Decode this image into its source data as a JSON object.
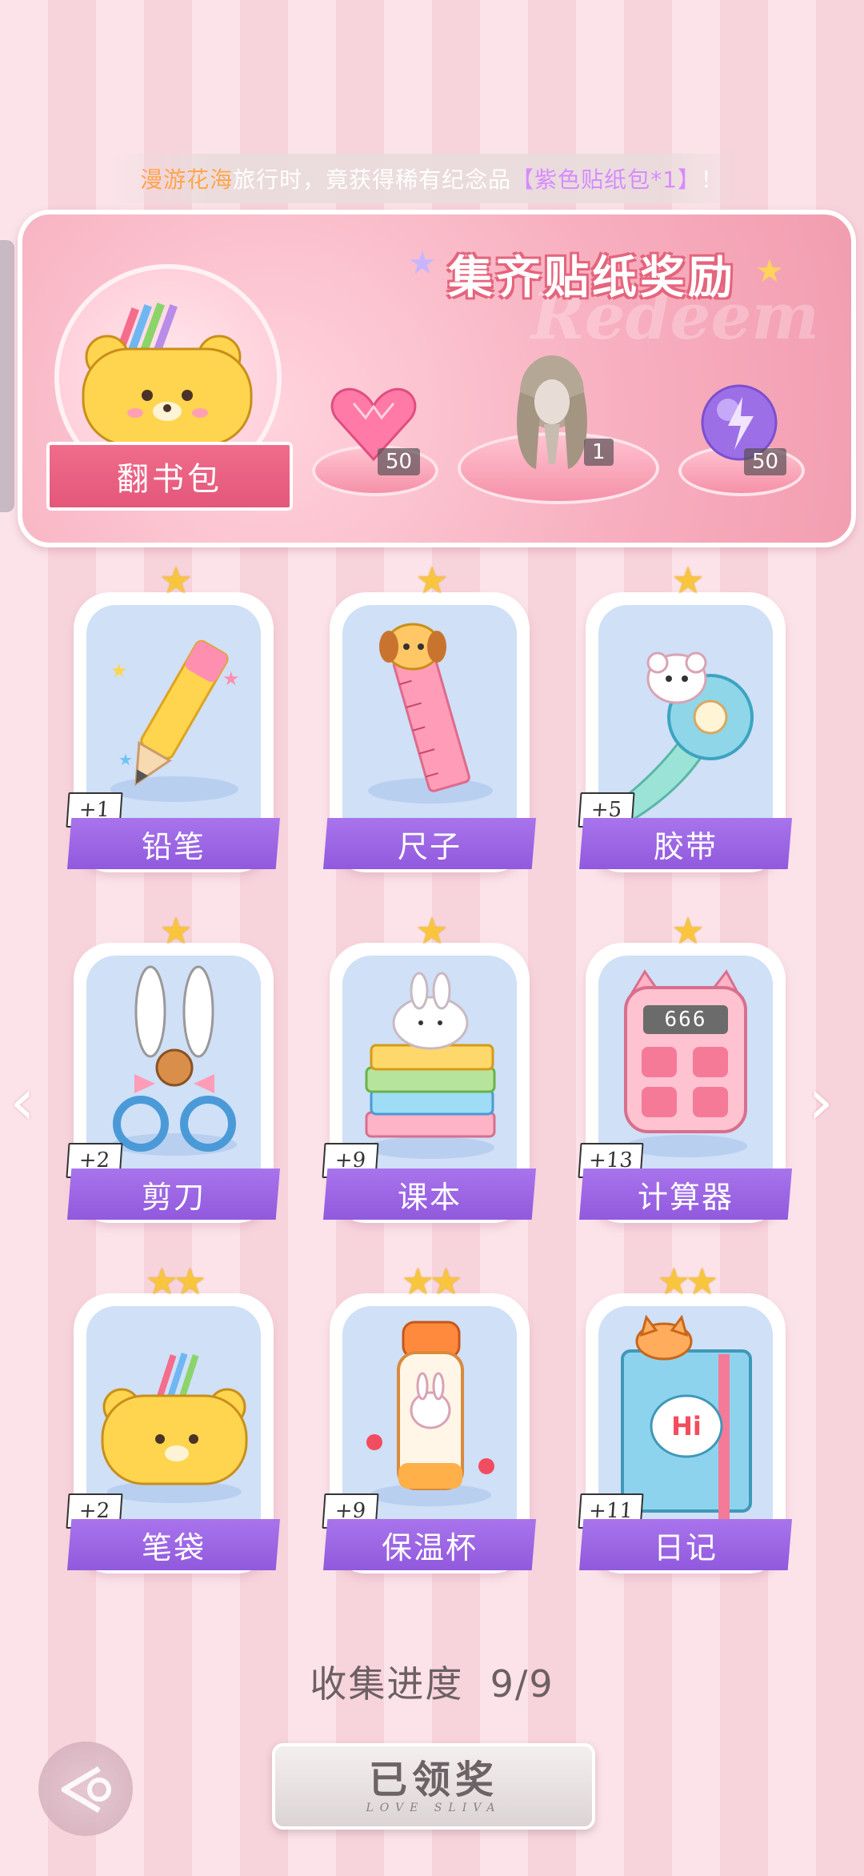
{
  "notice": {
    "place": "漫游花海",
    "mid": "旅行时，竟获得稀有纪念品",
    "item": "【紫色贴纸包*1】",
    "end": "！"
  },
  "banner": {
    "title": "集齐贴纸奖励",
    "watermark": "Redeem",
    "bag_label": "翻书包",
    "rewards": [
      {
        "name": "pink-heart-gem",
        "qty": "50"
      },
      {
        "name": "hairstyle",
        "qty": "1"
      },
      {
        "name": "purple-energy-orb",
        "qty": "50"
      }
    ]
  },
  "stickers": [
    {
      "label": "铅笔",
      "plus": "+1",
      "stars": "★"
    },
    {
      "label": "尺子",
      "plus": "",
      "stars": "★"
    },
    {
      "label": "胶带",
      "plus": "+5",
      "stars": "★"
    },
    {
      "label": "剪刀",
      "plus": "+2",
      "stars": "★"
    },
    {
      "label": "课本",
      "plus": "+9",
      "stars": "★"
    },
    {
      "label": "计算器",
      "plus": "+13",
      "stars": "★"
    },
    {
      "label": "笔袋",
      "plus": "+2",
      "stars": "★★"
    },
    {
      "label": "保温杯",
      "plus": "+9",
      "stars": "★★"
    },
    {
      "label": "日记",
      "plus": "+11",
      "stars": "★★"
    }
  ],
  "calculator_display": "666",
  "diary_text": "Hi",
  "progress": {
    "label": "收集进度",
    "value": "9/9"
  },
  "claim": {
    "label": "已领奖",
    "sub": "LOVE SLIVA"
  },
  "colors": {
    "accent_purple": "#9a62e4",
    "banner_pink": "#f29db0",
    "star_gold": "#f8c53d"
  }
}
